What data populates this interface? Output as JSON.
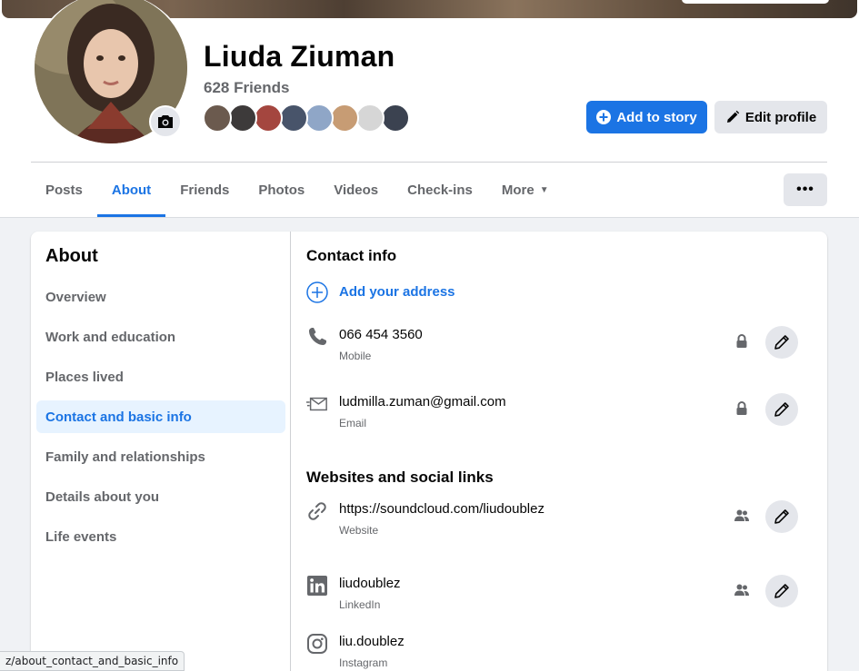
{
  "profile": {
    "name": "Liuda Ziuman",
    "friends_count": "628 Friends",
    "friend_avatar_colors": [
      "#6b5a4e",
      "#3d3a3a",
      "#a4463f",
      "#48546a",
      "#8fa6c7",
      "#c79c74",
      "#d6d6d6",
      "#3b4250"
    ]
  },
  "actions": {
    "add_story_label": "Add to story",
    "edit_profile_label": "Edit profile",
    "more_options": "•••"
  },
  "tabs": [
    {
      "label": "Posts",
      "active": false
    },
    {
      "label": "About",
      "active": true
    },
    {
      "label": "Friends",
      "active": false
    },
    {
      "label": "Photos",
      "active": false
    },
    {
      "label": "Videos",
      "active": false
    },
    {
      "label": "Check-ins",
      "active": false
    },
    {
      "label": "More",
      "active": false
    }
  ],
  "about": {
    "title": "About",
    "nav": [
      {
        "label": "Overview"
      },
      {
        "label": "Work and education"
      },
      {
        "label": "Places lived"
      },
      {
        "label": "Contact and basic info",
        "active": true
      },
      {
        "label": "Family and relationships"
      },
      {
        "label": "Details about you"
      },
      {
        "label": "Life events"
      }
    ]
  },
  "contact": {
    "title": "Contact info",
    "add_address": "Add your address",
    "phone": {
      "value": "066 454 3560",
      "type": "Mobile"
    },
    "email": {
      "value": "ludmilla.zuman@gmail.com",
      "type": "Email"
    }
  },
  "websites": {
    "title": "Websites and social links",
    "website": {
      "value": "https://soundcloud.com/liudoublez",
      "type": "Website"
    },
    "linkedin": {
      "value": "liudoublez",
      "type": "LinkedIn"
    },
    "instagram": {
      "value": "liu.doublez",
      "type": "Instagram"
    }
  },
  "status_url": "z/about_contact_and_basic_info",
  "colors": {
    "accent": "#1b74e4",
    "secondary_text": "#65676b",
    "button_gray": "#e4e6eb"
  }
}
